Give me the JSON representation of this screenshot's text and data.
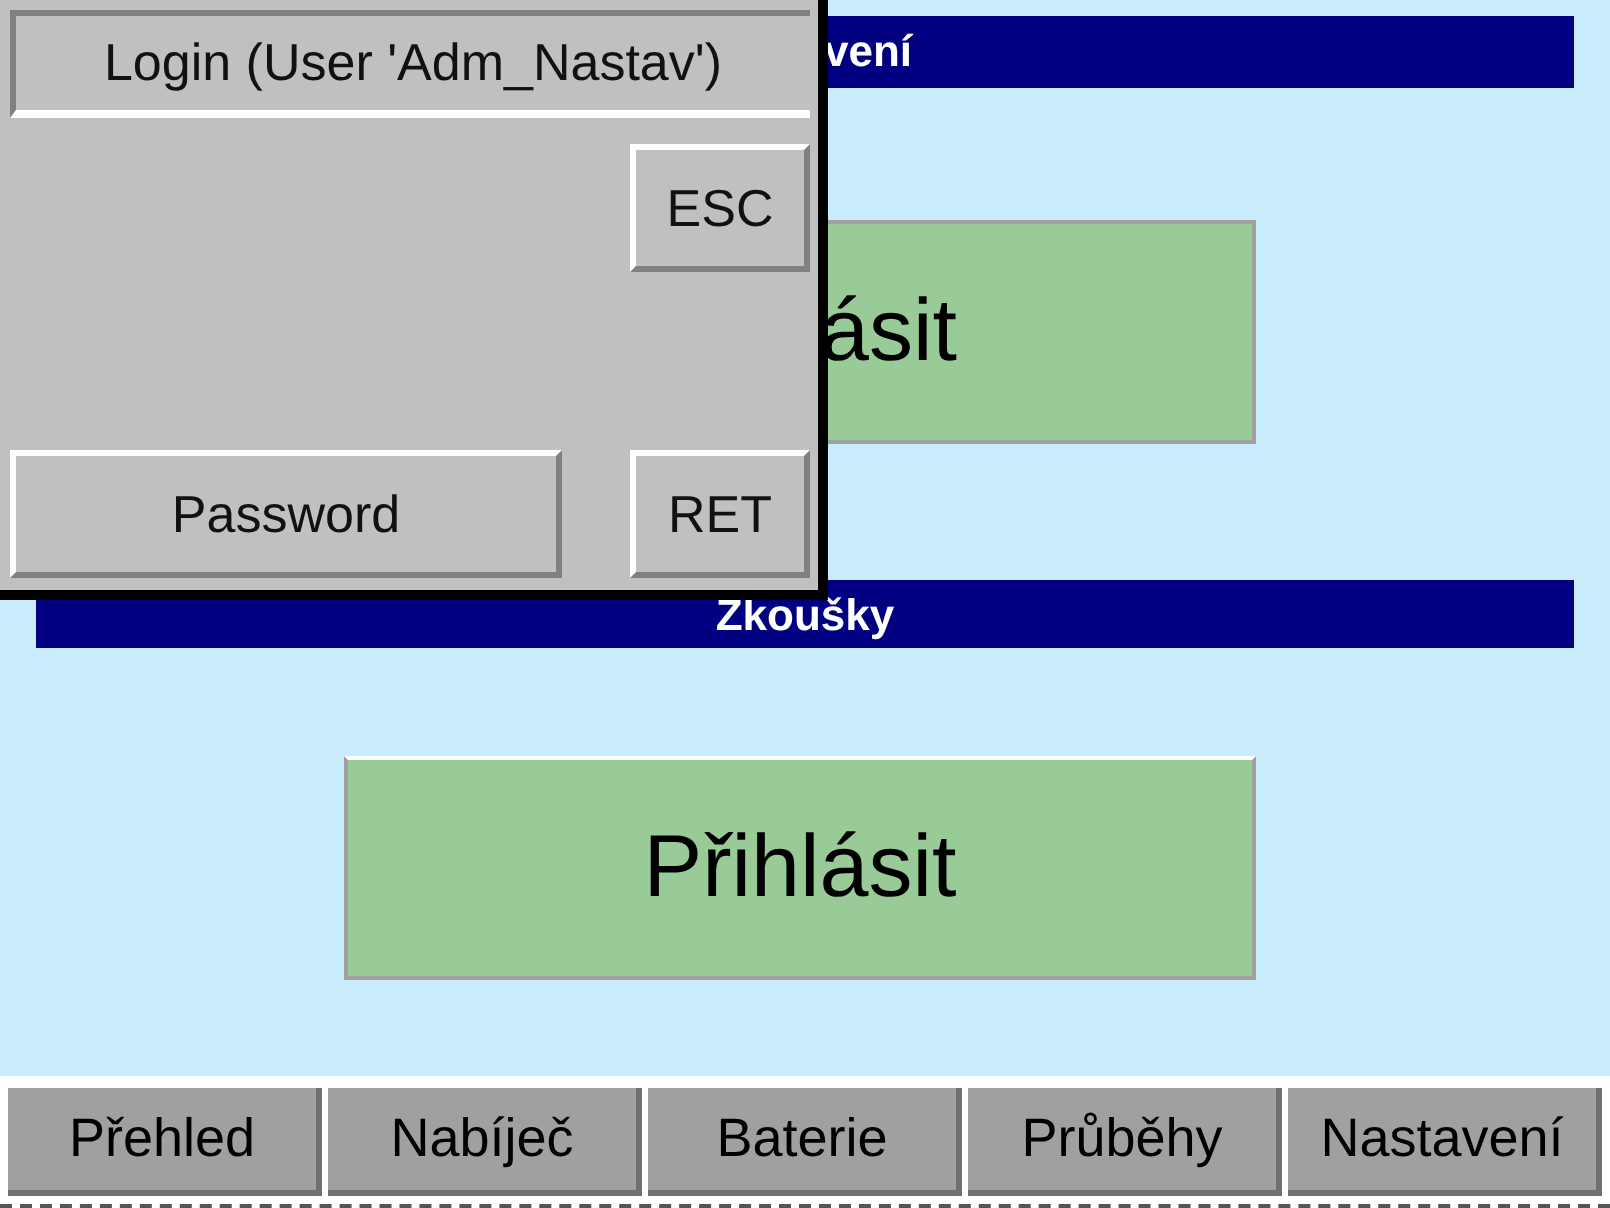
{
  "sections": [
    {
      "title": "vení",
      "button": "ásit"
    },
    {
      "title": "Zkoušky",
      "button": "Přihlásit"
    }
  ],
  "tabs": [
    {
      "label": "Přehled"
    },
    {
      "label": "Nabíječ"
    },
    {
      "label": "Baterie"
    },
    {
      "label": "Průběhy"
    },
    {
      "label": "Nastavení"
    }
  ],
  "dialog": {
    "title": "Login (User 'Adm_Nastav')",
    "escape": "ESC",
    "password": "Password",
    "return": "RET"
  }
}
